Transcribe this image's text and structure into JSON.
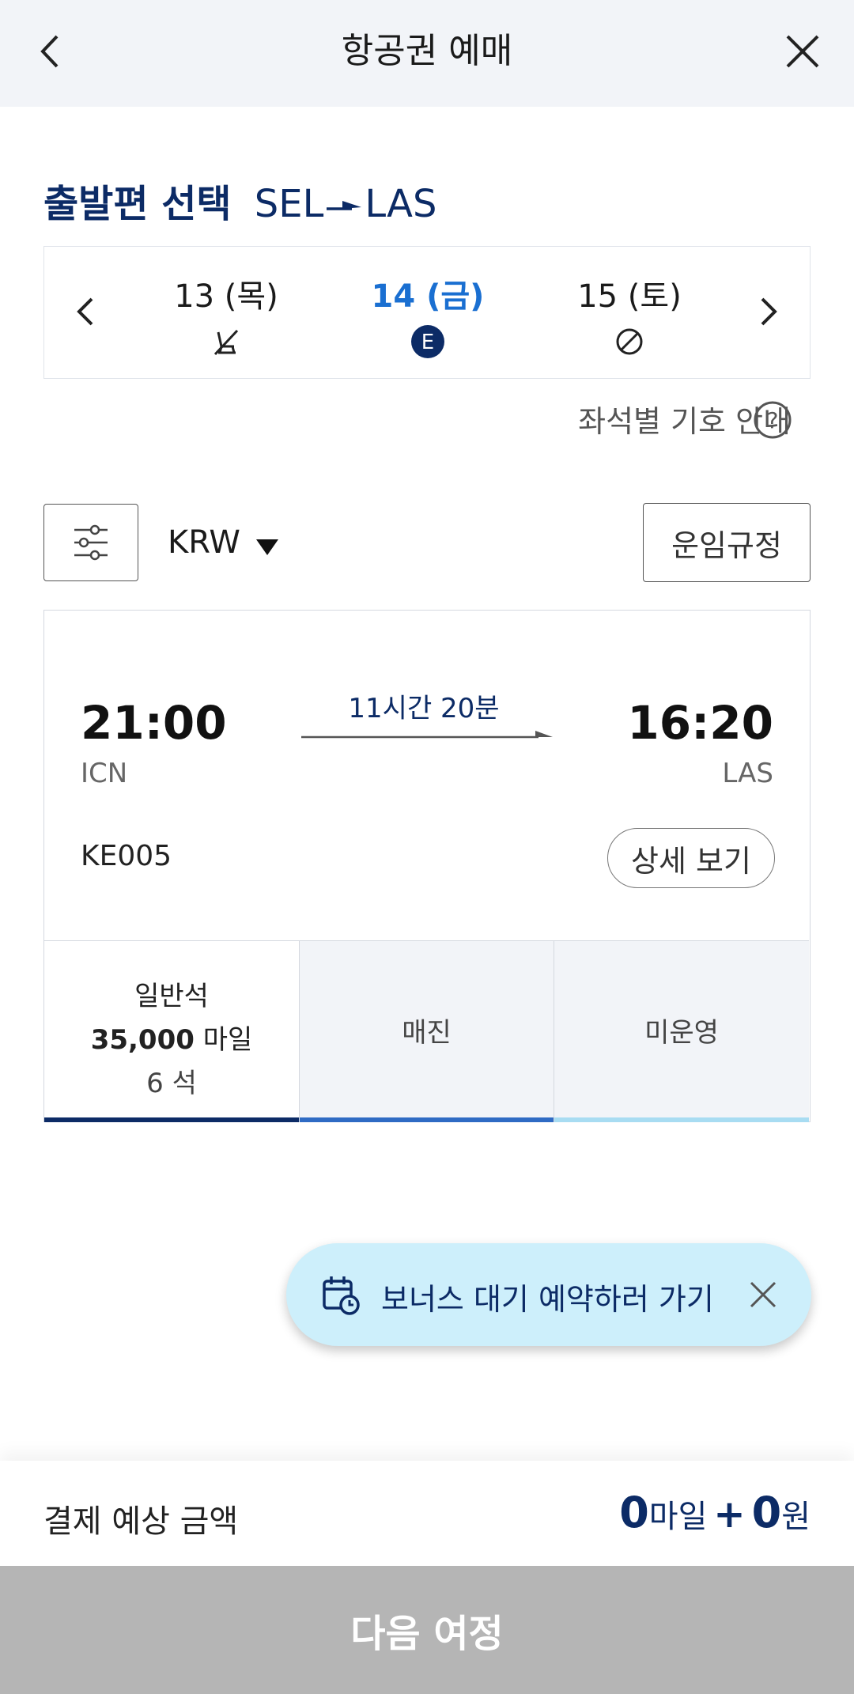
{
  "header": {
    "title": "항공권 예매"
  },
  "route": {
    "label": "출발편 선택",
    "origin": "SEL",
    "destination": "LAS"
  },
  "dates": [
    {
      "label": "13 (목)",
      "icon": "waitlist-seat-icon",
      "active": false
    },
    {
      "label": "14 (금)",
      "icon": "economy-e-badge-icon",
      "icon_text": "E",
      "active": true
    },
    {
      "label": "15 (토)",
      "icon": "unavailable-icon",
      "active": false
    }
  ],
  "seat_guide": {
    "label": "좌석별 기호 안내"
  },
  "currency": {
    "value": "KRW"
  },
  "fare_rules": {
    "label": "운임규정"
  },
  "flight": {
    "departure_time": "21:00",
    "arrival_time": "16:20",
    "departure_code": "ICN",
    "arrival_code": "LAS",
    "duration": "11시간 20분",
    "flight_number": "KE005",
    "detail_label": "상세 보기",
    "seats": {
      "economy": {
        "class": "일반석",
        "price": "35,000",
        "unit": "마일",
        "count": "6 석"
      },
      "col2": {
        "status": "매진"
      },
      "col3": {
        "status": "미운영"
      }
    }
  },
  "bonus": {
    "label": "보너스 대기 예약하러 가기"
  },
  "summary": {
    "label": "결제 예상 금액",
    "miles": "0",
    "miles_unit": "마일",
    "plus": "+",
    "won": "0",
    "won_unit": "원"
  },
  "next": {
    "label": "다음 여정"
  },
  "colors": {
    "navy": "#0c2b66",
    "active_blue": "#1a6fd1",
    "pill_bg": "#cdeffb",
    "disabled": "#b5b5b5"
  }
}
